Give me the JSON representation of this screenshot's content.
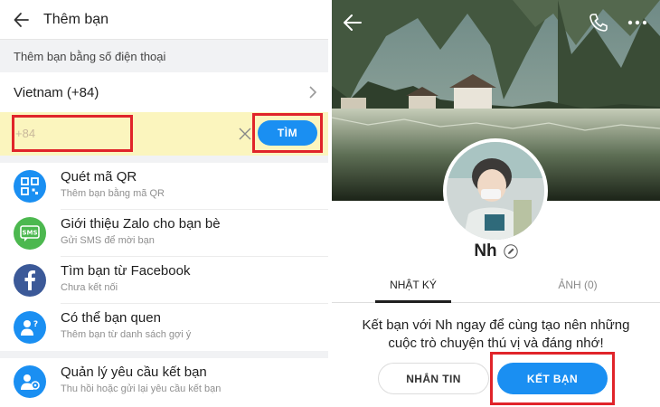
{
  "left": {
    "header": {
      "title": "Thêm bạn"
    },
    "section_caption": "Thêm bạn bằng số điện thoại",
    "country": {
      "label": "Vietnam (+84)"
    },
    "phone": {
      "value": "+84"
    },
    "find_button": "TÌM",
    "menu": [
      {
        "title": "Quét mã QR",
        "subtitle": "Thêm bạn bằng mã QR",
        "icon": "qr-code-icon",
        "color": "#1a8ff2"
      },
      {
        "title": "Giới thiệu Zalo cho bạn bè",
        "subtitle": "Gửi SMS để mời bạn",
        "icon": "sms-icon",
        "color": "#4cb84f"
      },
      {
        "title": "Tìm bạn từ Facebook",
        "subtitle": "Chưa kết nối",
        "icon": "facebook-icon",
        "color": "#3b5998"
      },
      {
        "title": "Có thể bạn quen",
        "subtitle": "Thêm bạn từ danh sách gợi ý",
        "icon": "contacts-icon",
        "color": "#1a8ff2"
      },
      {
        "title": "Quản lý yêu cầu kết bạn",
        "subtitle": "Thu hồi hoặc gửi lại yêu cầu kết bạn",
        "icon": "friend-request-icon",
        "color": "#1a8ff2"
      }
    ]
  },
  "right": {
    "profile": {
      "name": "Nh"
    },
    "tabs": [
      {
        "label": "NHẬT KÝ",
        "active": true
      },
      {
        "label": "ẢNH (0)",
        "active": false
      }
    ],
    "invite_text": "Kết bạn với Nh ngay để cùng tạo nên những cuộc trò chuyện thú vị và đáng nhớ!",
    "message_button": "NHẮN TIN",
    "add_friend_button": "KẾT BẠN"
  },
  "colors": {
    "accent": "#1a8ff2",
    "highlight_border": "#e0242a",
    "input_background": "#fbf5be"
  }
}
